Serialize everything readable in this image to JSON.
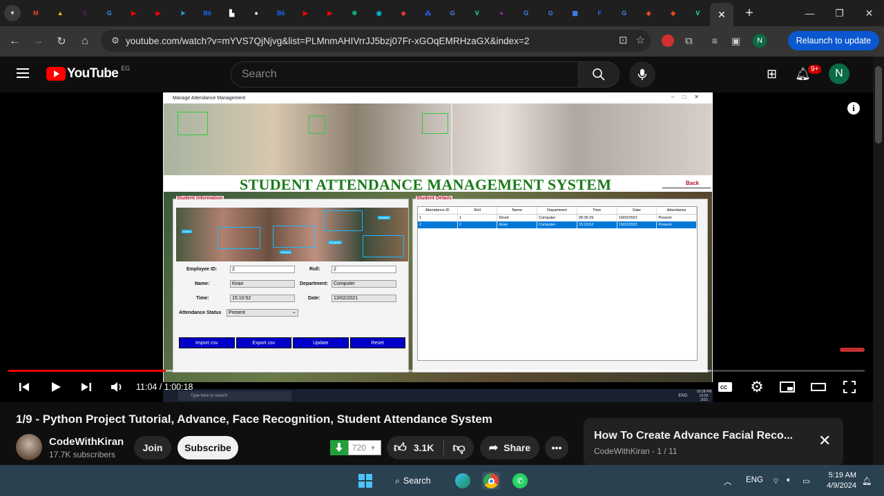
{
  "browser": {
    "tabs": [
      {
        "icon": "gmail-icon",
        "color": "#ea4335",
        "glyph": "M"
      },
      {
        "icon": "google-drive-icon",
        "color": "#fbbc04",
        "glyph": "▲"
      },
      {
        "icon": "slack-icon",
        "color": "#611f69",
        "glyph": "S"
      },
      {
        "icon": "google-icon",
        "color": "#4285f4",
        "glyph": "G"
      },
      {
        "icon": "youtube-icon",
        "color": "#ff0000",
        "glyph": "▶"
      },
      {
        "icon": "youtube-icon",
        "color": "#ff0000",
        "glyph": "▶"
      },
      {
        "icon": "telegram-icon",
        "color": "#2aabee",
        "glyph": "➤"
      },
      {
        "icon": "behance-icon",
        "color": "#1769ff",
        "glyph": "Bē"
      },
      {
        "icon": "document-icon",
        "color": "#ffffff",
        "glyph": "▙"
      },
      {
        "icon": "github-icon",
        "color": "#ffffff",
        "glyph": "●"
      },
      {
        "icon": "behance-icon",
        "color": "#1769ff",
        "glyph": "Bē"
      },
      {
        "icon": "youtube-icon",
        "color": "#ff0000",
        "glyph": "▶"
      },
      {
        "icon": "youtube-icon",
        "color": "#ff0000",
        "glyph": "▶"
      },
      {
        "icon": "chatgpt-icon",
        "color": "#10a37f",
        "glyph": "✺"
      },
      {
        "icon": "chat-icon",
        "color": "#00bcd4",
        "glyph": "◉"
      },
      {
        "icon": "app-icon",
        "color": "#e53935",
        "glyph": "◆"
      },
      {
        "icon": "grid-icon",
        "color": "#2962ff",
        "glyph": "⁂"
      },
      {
        "icon": "google-icon",
        "color": "#4285f4",
        "glyph": "G"
      },
      {
        "icon": "vuetify-icon",
        "color": "#1de9b6",
        "glyph": "V"
      },
      {
        "icon": "drop-icon",
        "color": "#9c27b0",
        "glyph": "●"
      },
      {
        "icon": "google-icon",
        "color": "#4285f4",
        "glyph": "G"
      },
      {
        "icon": "google-icon",
        "color": "#4285f4",
        "glyph": "G"
      },
      {
        "icon": "news-icon",
        "color": "#4285f4",
        "glyph": "▦"
      },
      {
        "icon": "forms-icon",
        "color": "#1a73e8",
        "glyph": "F"
      },
      {
        "icon": "google-icon",
        "color": "#4285f4",
        "glyph": "G"
      },
      {
        "icon": "figma-icon",
        "color": "#f24e1e",
        "glyph": "◈"
      },
      {
        "icon": "figma-icon",
        "color": "#f24e1e",
        "glyph": "◈"
      },
      {
        "icon": "vuetify-icon",
        "color": "#1de9b6",
        "glyph": "V"
      }
    ],
    "active_tab": {
      "icon": "vuetify-icon",
      "glyph": "V",
      "close": "✕"
    },
    "new_tab": "+",
    "url": "youtube.com/watch?v=mYVS7QjNjvg&list=PLMnmAHIVrrJJ5bzj07Fr-xGOqEMRHzaGX&index=2",
    "relaunch_label": "Relaunch to update",
    "profile_initial": "N"
  },
  "youtube": {
    "logo_text": "YouTube",
    "country_code": "EG",
    "search_placeholder": "Search",
    "notifications_badge": "9+",
    "avatar_initial": "N"
  },
  "video_frame": {
    "window_title": "Manage Attendance Management",
    "heading": "STUDENT ATTENDANCE MANAGEMENT SYSTEM",
    "back_label": "Back",
    "student_info_legend": "Student Information",
    "student_details_legend": "Student Details",
    "form": {
      "employee_id_label": "Employee ID:",
      "employee_id_value": "2",
      "roll_label": "Roll:",
      "roll_value": "2",
      "name_label": "Name:",
      "name_value": "Kiran",
      "department_label": "Department:",
      "department_value": "Computer",
      "time_label": "Time:",
      "time_value": "15:10:52",
      "date_label": "Date:",
      "date_value": "13/02/2021",
      "status_label": "Attendance Status",
      "status_value": "Present"
    },
    "buttons": [
      "Import csv",
      "Export csv",
      "Update",
      "Reset"
    ],
    "table": {
      "headers": [
        "Attendance ID",
        "Roll",
        "Name",
        "Department",
        "Time",
        "Date",
        "Attendance"
      ],
      "rows": [
        [
          "1",
          "1",
          "Devid",
          "Computer",
          "09:36:29",
          "13/02/2021",
          "Present"
        ],
        [
          "2",
          "2",
          "Kiran",
          "Computer",
          "15:10:52",
          "13/02/2021",
          "Present"
        ]
      ],
      "selected_row": 1
    },
    "face_labels": [
      "Cristin",
      "Jessica",
      "Elizabeth",
      "Scarlett"
    ],
    "taskbar_search": "Type here to search",
    "taskbar_clock": "03:28 PM",
    "taskbar_date": "13-02-2021",
    "taskbar_lang": "ENG"
  },
  "player": {
    "time_current": "11:04",
    "time_total": "1:00:18",
    "progress_fraction": 0.184,
    "buffered_fraction": 0.82
  },
  "video_info": {
    "title": "1/9 - Python Project Tutorial, Advance, Face Recognition, Student Attendance System",
    "channel_name": "CodeWithKiran",
    "subscribers": "17.7K subscribers",
    "join_label": "Join",
    "subscribe_label": "Subscribe",
    "download_count": "720",
    "likes": "3.1K",
    "share_label": "Share"
  },
  "playlist_card": {
    "title": "How To Create Advance Facial Reco...",
    "subtitle": "CodeWithKiran - 1 / 11"
  },
  "taskbar": {
    "search_label": "Search",
    "lang": "ENG",
    "time": "5:19 AM",
    "date": "4/9/2024"
  }
}
